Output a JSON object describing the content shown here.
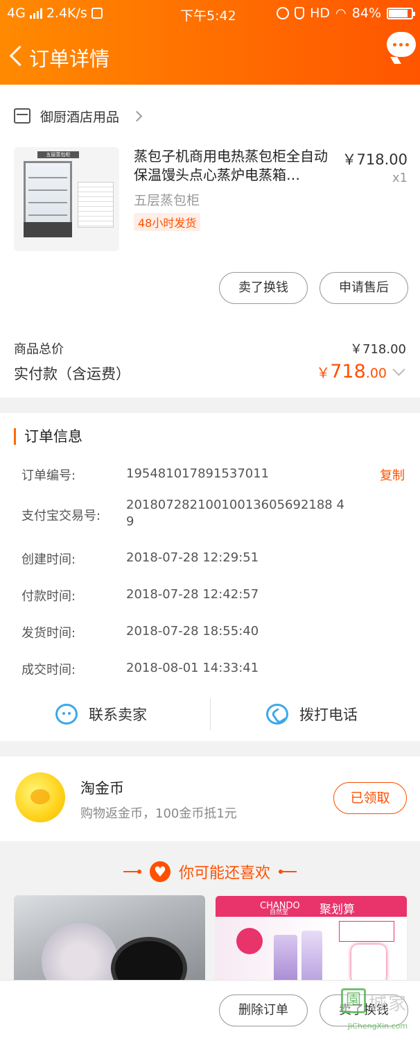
{
  "status_bar": {
    "network": "4G",
    "speed": "2.4K/s",
    "time": "下午5:42",
    "hd": "HD",
    "battery": "84%"
  },
  "nav": {
    "title": "订单详情"
  },
  "shop": {
    "name": "御厨酒店用品"
  },
  "product": {
    "title": "蒸包子机商用电热蒸包柜全自动保温馒头点心蒸炉电蒸箱…",
    "price": "￥718.00",
    "qty": "x1",
    "sku": "五层蒸包柜",
    "tag": "48小时发货",
    "image_label": "五层蒸包柜"
  },
  "item_actions": {
    "sell_label": "卖了换钱",
    "aftersale_label": "申请售后"
  },
  "summary": {
    "total_label": "商品总价",
    "total_value": "￥718.00",
    "paid_label": "实付款（含运费）",
    "paid_currency": "￥",
    "paid_int": "718",
    "paid_dec": ".00"
  },
  "order_info": {
    "title": "订单信息",
    "copy_label": "复制",
    "rows": [
      {
        "label": "订单编号:",
        "value": "195481017891537011"
      },
      {
        "label": "支付宝交易号:",
        "value": "20180728210010013605692188 49"
      },
      {
        "label": "创建时间:",
        "value": "2018-07-28 12:29:51"
      },
      {
        "label": "付款时间:",
        "value": "2018-07-28 12:42:57"
      },
      {
        "label": "发货时间:",
        "value": "2018-07-28 18:55:40"
      },
      {
        "label": "成交时间:",
        "value": "2018-08-01 14:33:41"
      }
    ]
  },
  "contact": {
    "seller_label": "联系卖家",
    "phone_label": "拨打电话"
  },
  "coins": {
    "title": "淘金币",
    "subtitle": "购物返金币，100金币抵1元",
    "button": "已领取"
  },
  "recommend": {
    "title": "你可能还喜欢",
    "card2_brand": "CHANDO",
    "card2_brand_cn": "自然堂",
    "card2_promo": "聚划算"
  },
  "bottom": {
    "delete_label": "删除订单",
    "sell_label": "卖了换钱"
  },
  "watermark": {
    "glyph": "園",
    "text": "城家",
    "url": "JiChengXin.com"
  },
  "colors": {
    "accent": "#ff5000",
    "header_start": "#ff8a00",
    "header_end": "#ff5500",
    "link_blue": "#3aa8e8"
  }
}
